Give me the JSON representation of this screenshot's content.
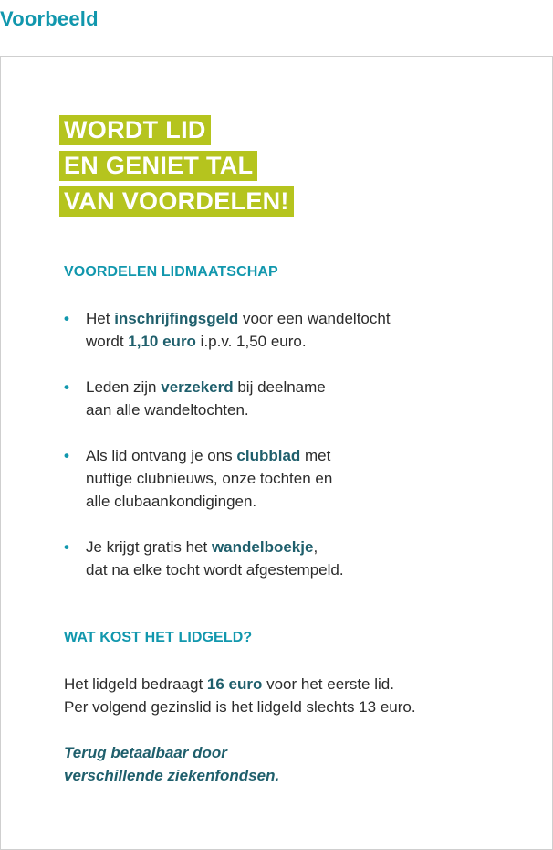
{
  "page_heading": "Voorbeeld",
  "hero": {
    "lines": [
      "WORDT LID",
      "EN GENIET TAL",
      "VAN VOORDELEN!"
    ]
  },
  "benefits_section": {
    "title": "VOORDELEN LIDMAATSCHAP",
    "items": [
      {
        "bullet": "•",
        "l1_a": "Het ",
        "l1_hl": "inschrijfingsgeld",
        "l1_b": " voor een wandeltocht",
        "l2_a": "wordt ",
        "l2_hl": "1,10 euro",
        "l2_b": " i.p.v. 1,50 euro."
      },
      {
        "bullet": "•",
        "l1_a": "Leden zijn ",
        "l1_hl": "verzekerd",
        "l1_b": " bij deelname",
        "l2": "aan alle wandeltochten."
      },
      {
        "bullet": "•",
        "l1_a": "Als lid ontvang je ons ",
        "l1_hl": "clubblad",
        "l1_b": " met",
        "l2": "nuttige clubnieuws, onze tochten en",
        "l3": "alle clubaankondigingen."
      },
      {
        "bullet": "•",
        "l1_a": "Je krijgt gratis het ",
        "l1_hl": "wandelboekje",
        "l1_b": ",",
        "l2": "dat na elke tocht wordt afgestempeld."
      }
    ]
  },
  "price_section": {
    "title": "WAT KOST HET LIDGELD?",
    "l1_a": "Het lidgeld bedraagt ",
    "l1_hl": "16 euro",
    "l1_b": " voor het eerste lid.",
    "l2": "Per volgend gezinslid is het lidgeld slechts 13 euro.",
    "note_l1": "Terug betaalbaar door",
    "note_l2": "verschillende ziekenfondsen."
  },
  "colors": {
    "accent_teal": "#1197ad",
    "highlight_dark_teal": "#1f5f6c",
    "hero_lime": "#b5c41e",
    "text": "#2b2b2b",
    "border": "#cfcfcf"
  }
}
